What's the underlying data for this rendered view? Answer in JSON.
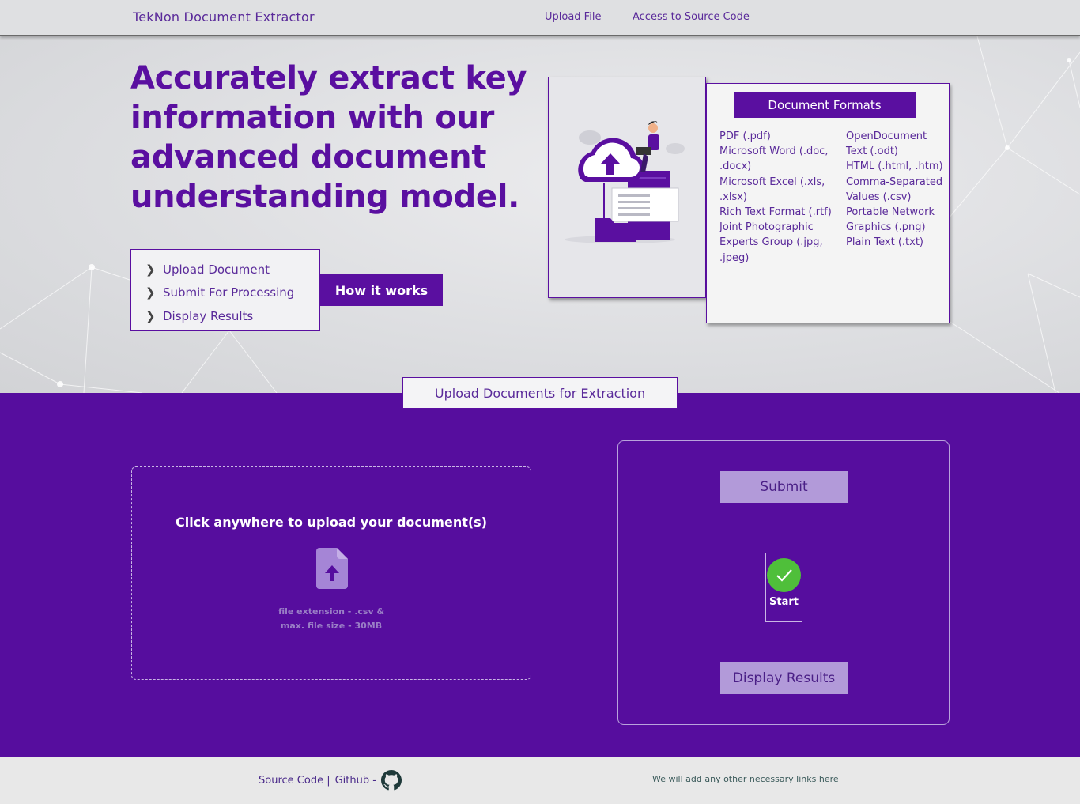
{
  "header": {
    "brand": "TekNon Document Extractor",
    "nav": [
      {
        "label": "Upload File"
      },
      {
        "label": "Access to Source Code"
      }
    ]
  },
  "hero": {
    "headline": "Accurately extract key information with our advanced document understanding model.",
    "steps": [
      {
        "label": "Upload Document"
      },
      {
        "label": "Submit For Processing"
      },
      {
        "label": "Display Results"
      }
    ],
    "how_button": "How it works"
  },
  "formats": {
    "title": "Document Formats",
    "left": [
      "PDF (.pdf)",
      "Microsoft Word (.doc, .docx)",
      "Microsoft Excel (.xls, .xlsx)",
      "Rich Text Format (.rtf)",
      "Joint Photographic Experts Group (.jpg, .jpeg)"
    ],
    "right": [
      "OpenDocument Text (.odt)",
      "HTML (.html, .htm)",
      "Comma-Separated Values (.csv)",
      "Portable Network Graphics (.png)",
      "Plain Text (.txt)"
    ]
  },
  "upload": {
    "section_title": "Upload Documents for Extraction",
    "dropzone_title": "Click anywhere to upload your document(s)",
    "note_line1": "file extension - .csv &",
    "note_line2": "max. file size - 30MB",
    "submit_label": "Submit",
    "start_label": "Start",
    "display_label": "Display Results"
  },
  "footer": {
    "source_code": "Source Code |",
    "github": "Github -",
    "other_links": "We will add any other necessary links here"
  },
  "colors": {
    "brand_purple": "#5a0fa0",
    "section_purple": "#560d9e",
    "button_lavender": "#b29ad9",
    "success_green": "#4fbf3a"
  },
  "icons": [
    "chevron-right-icon",
    "cloud-upload-illustration",
    "file-upload-icon",
    "check-icon",
    "github-icon"
  ]
}
